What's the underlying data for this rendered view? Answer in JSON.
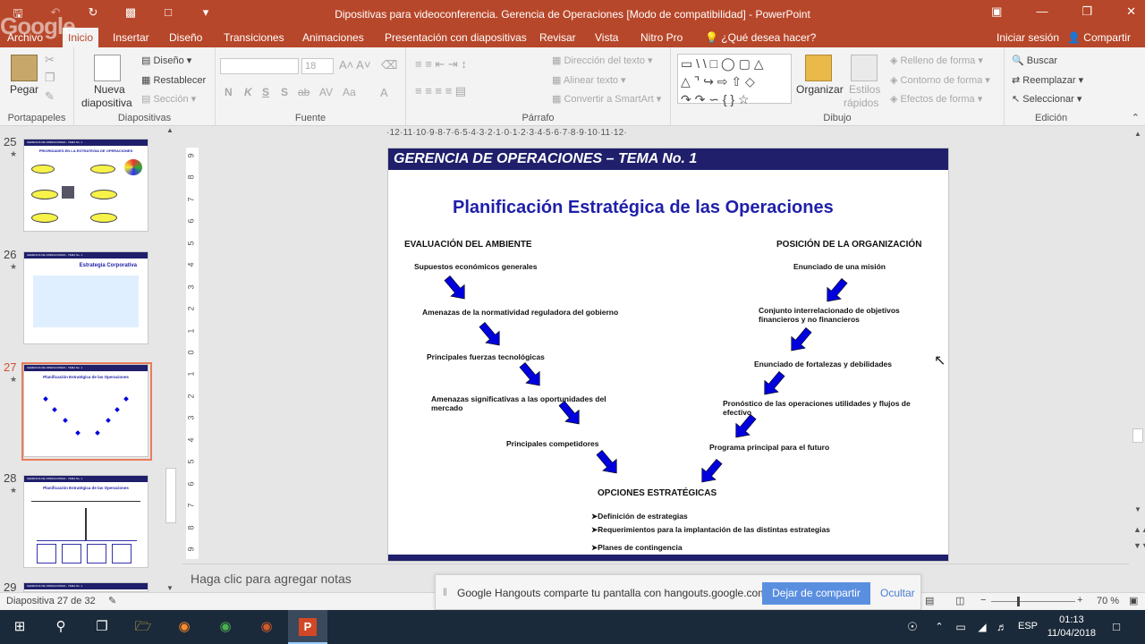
{
  "window": {
    "title": "Dipositivas para videoconferencia. Gerencia de Operaciones [Modo de compatibilidad] - PowerPoint",
    "google_overlay": "Google"
  },
  "tabs": [
    "Archivo",
    "Inicio",
    "Insertar",
    "Diseño",
    "Transiciones",
    "Animaciones",
    "Presentación con diapositivas",
    "Revisar",
    "Vista",
    "Nitro Pro"
  ],
  "tell_me": "¿Qué desea hacer?",
  "signin": "Iniciar sesión",
  "share": "Compartir",
  "ribbon": {
    "portapapeles": {
      "label": "Portapapeles",
      "pegar": "Pegar"
    },
    "diapositivas": {
      "label": "Diapositivas",
      "nueva_1": "Nueva",
      "nueva_2": "diapositiva",
      "diseno": "Diseño",
      "restablecer": "Restablecer",
      "seccion": "Sección"
    },
    "fuente": {
      "label": "Fuente",
      "size": "18",
      "fmt": [
        "N",
        "K",
        "S",
        "S",
        "ab",
        "AV",
        "Aa",
        "A"
      ]
    },
    "parrafo": {
      "label": "Párrafo",
      "dir_texto": "Dirección del texto",
      "alinear": "Alinear texto",
      "smartart": "Convertir a SmartArt"
    },
    "dibujo": {
      "label": "Dibujo",
      "organizar": "Organizar",
      "estilos_1": "Estilos",
      "estilos_2": "rápidos",
      "relleno": "Relleno de forma",
      "contorno": "Contorno de forma",
      "efectos": "Efectos de forma"
    },
    "edicion": {
      "label": "Edición",
      "buscar": "Buscar",
      "reemplazar": "Reemplazar",
      "seleccionar": "Seleccionar"
    }
  },
  "thumbnails": [
    {
      "num": "25",
      "hdr": "GERENCIA DE OPERACIONES - TEMA No. 1",
      "title": "PRIORIDADES EN LA ESTRATEGIA DE OPERACIONES"
    },
    {
      "num": "26",
      "hdr": "GERENCIA DE OPERACIONES - TEMA No. 1",
      "title": "Estrategia Corporativa"
    },
    {
      "num": "27",
      "hdr": "GERENCIA DE OPERACIONES - TEMA No. 1",
      "title": "Planificación Estratégica de las Operaciones"
    },
    {
      "num": "28",
      "hdr": "GERENCIA DE OPERACIONES - TEMA No. 1",
      "title": "Planificación Estratégica de las Operaciones"
    },
    {
      "num": "29",
      "hdr": "GERENCIA DE OPERACIONES - TEMA No. 1",
      "title": ""
    }
  ],
  "ruler": {
    "h": "·12·11·10·9·8·7·6·5·4·3·2·1·0·1·2·3·4·5·6·7·8·9·10·11·12·",
    "v": [
      "9",
      "8",
      "7",
      "6",
      "5",
      "4",
      "3",
      "2",
      "1",
      "0",
      "1",
      "2",
      "3",
      "4",
      "5",
      "6",
      "7",
      "8",
      "9"
    ]
  },
  "slide": {
    "header": "GERENCIA DE OPERACIONES – TEMA No. 1",
    "title": "Planificación Estratégica de las  Operaciones",
    "left_head": "EVALUACIÓN DEL AMBIENTE",
    "right_head": "POSICIÓN DE LA ORGANIZACIÓN",
    "left_items": [
      "Supuestos económicos generales",
      "Amenazas de la normatividad reguladora del gobierno",
      "Principales fuerzas tecnológicas",
      "Amenazas significativas a las oportunidades del mercado",
      "Principales competidores"
    ],
    "right_items": [
      "Enunciado de una misión",
      "Conjunto interrelacionado de objetivos financieros y  no financieros",
      "Enunciado de fortalezas y debilidades",
      "Pronóstico de las operaciones utilidades y  flujos de efectivo",
      "Programa principal para el futuro"
    ],
    "center_head": "OPCIONES ESTRATÉGICAS",
    "center_items": [
      "Definición de estrategias",
      "Requerimientos para la implantación de las distintas estrategias",
      "Planes de contingencia"
    ],
    "arrow_color": "#0000dd"
  },
  "notes_placeholder": "Haga clic para agregar notas",
  "status": {
    "slide_info": "Diapositiva 27 de 32",
    "zoom": "70 %"
  },
  "hangouts": {
    "message": "Google Hangouts comparte tu pantalla con hangouts.google.com.",
    "stop": "Dejar de compartir",
    "hide": "Ocultar"
  },
  "taskbar": {
    "lang": "ESP",
    "time": "01:13",
    "date": "11/04/2018"
  }
}
